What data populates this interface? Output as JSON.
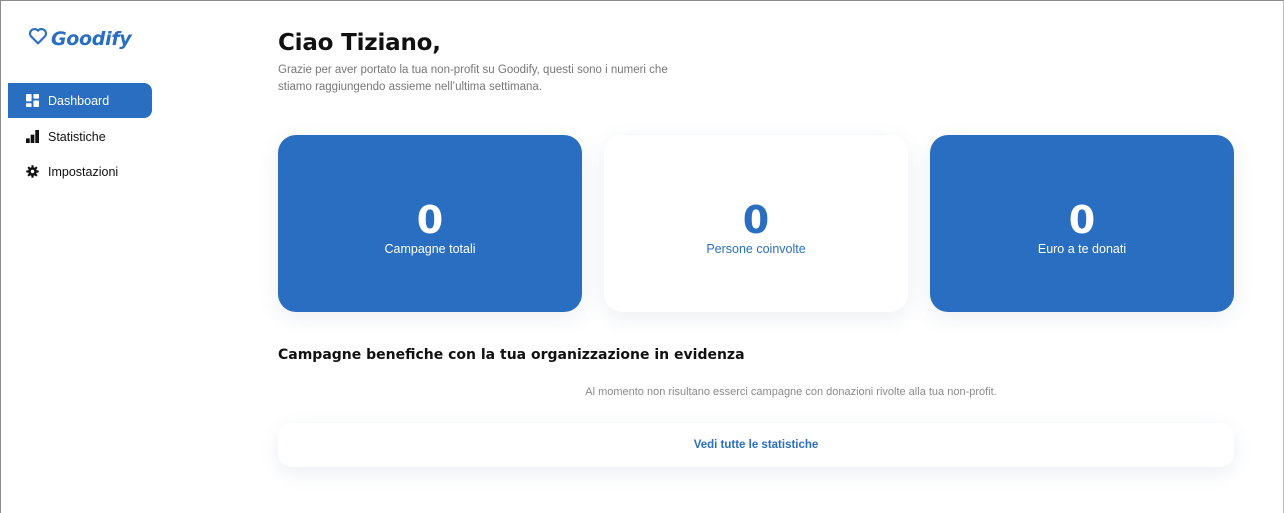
{
  "app": {
    "name": "Goodify",
    "brand_color": "#2a6ec2"
  },
  "sidebar": {
    "items": [
      {
        "label": "Dashboard",
        "icon": "dashboard-grid-icon",
        "active": true
      },
      {
        "label": "Statistiche",
        "icon": "bar-chart-icon",
        "active": false
      },
      {
        "label": "Impostazioni",
        "icon": "gear-icon",
        "active": false
      }
    ]
  },
  "header": {
    "greeting": "Ciao Tiziano,",
    "subtitle": "Grazie per aver portato la tua non-profit su Goodify, questi sono i numeri che stiamo raggiungendo assieme nell’ultima settimana."
  },
  "stats": [
    {
      "value": "0",
      "label": "Campagne totali",
      "style": "blue"
    },
    {
      "value": "0",
      "label": "Persone coinvolte",
      "style": "white"
    },
    {
      "value": "0",
      "label": "Euro a te donati",
      "style": "blue"
    }
  ],
  "featured": {
    "title": "Campagne benefiche con la tua organizzazione in evidenza",
    "empty_message": "Al momento non risultano esserci campagne con donazioni rivolte alla tua non-profit.",
    "all_stats_label": "Vedi tutte le statistiche"
  }
}
